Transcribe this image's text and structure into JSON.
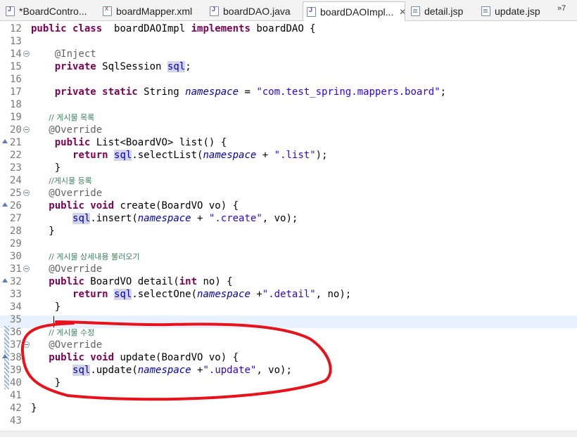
{
  "tabs": [
    {
      "label": "*BoardContro...",
      "icon": "java-file-icon",
      "active": false
    },
    {
      "label": "boardMapper.xml",
      "icon": "xml-file-icon",
      "active": false
    },
    {
      "label": "boardDAO.java",
      "icon": "java-file-icon",
      "active": false
    },
    {
      "label": "boardDAOImpl...",
      "icon": "java-file-icon",
      "active": true,
      "close": "✕"
    },
    {
      "label": "detail.jsp",
      "icon": "jsp-file-icon",
      "active": false
    },
    {
      "label": "update.jsp",
      "icon": "jsp-file-icon",
      "active": false
    }
  ],
  "overflow": "»7",
  "editor": {
    "current_line": 35,
    "lines": [
      {
        "num": "12",
        "code": [
          [
            "kw",
            "public class"
          ],
          [
            "",
            "  boardDAOImpl "
          ],
          [
            "kw",
            "implements"
          ],
          [
            "",
            " boardDAO {"
          ]
        ]
      },
      {
        "num": "13",
        "code": []
      },
      {
        "num": "14",
        "fold": true,
        "code": [
          [
            "",
            "    "
          ],
          [
            "ann",
            "@Inject"
          ]
        ]
      },
      {
        "num": "15",
        "code": [
          [
            "",
            "    "
          ],
          [
            "kw",
            "private"
          ],
          [
            "",
            " SqlSession "
          ],
          [
            "occ",
            "sql"
          ],
          [
            "",
            ";"
          ]
        ]
      },
      {
        "num": "16",
        "code": []
      },
      {
        "num": "17",
        "code": [
          [
            "",
            "    "
          ],
          [
            "kw",
            "private static"
          ],
          [
            "",
            " String "
          ],
          [
            "fld",
            "namespace"
          ],
          [
            "",
            " = "
          ],
          [
            "str",
            "\"com.test_spring.mappers.board\""
          ],
          [
            "",
            ";"
          ]
        ]
      },
      {
        "num": "18",
        "code": []
      },
      {
        "num": "19",
        "code": [
          [
            "",
            "   "
          ],
          [
            "cm",
            "// 게시물 목록"
          ]
        ]
      },
      {
        "num": "20",
        "fold": true,
        "code": [
          [
            "",
            "   "
          ],
          [
            "ann",
            "@Override"
          ]
        ]
      },
      {
        "num": "21",
        "override": true,
        "code": [
          [
            "",
            "    "
          ],
          [
            "kw",
            "public"
          ],
          [
            "",
            " List<BoardVO> list() {"
          ]
        ]
      },
      {
        "num": "22",
        "code": [
          [
            "",
            "       "
          ],
          [
            "kw",
            "return"
          ],
          [
            "",
            " "
          ],
          [
            "occ",
            "sql"
          ],
          [
            "",
            ".selectList("
          ],
          [
            "fld",
            "namespace"
          ],
          [
            "",
            " + "
          ],
          [
            "str",
            "\".list\""
          ],
          [
            "",
            ");"
          ]
        ]
      },
      {
        "num": "23",
        "code": [
          [
            "",
            "    }"
          ]
        ]
      },
      {
        "num": "24",
        "code": [
          [
            "",
            "   "
          ],
          [
            "cm",
            "//게시물 등록"
          ]
        ]
      },
      {
        "num": "25",
        "fold": true,
        "code": [
          [
            "",
            "   "
          ],
          [
            "ann",
            "@Override"
          ]
        ]
      },
      {
        "num": "26",
        "override": true,
        "code": [
          [
            "",
            "   "
          ],
          [
            "kw",
            "public void"
          ],
          [
            "",
            " create(BoardVO vo) {"
          ]
        ]
      },
      {
        "num": "27",
        "code": [
          [
            "",
            "       "
          ],
          [
            "occ",
            "sql"
          ],
          [
            "",
            ".insert("
          ],
          [
            "fld",
            "namespace"
          ],
          [
            "",
            " + "
          ],
          [
            "str",
            "\".create\""
          ],
          [
            "",
            ", vo);"
          ]
        ]
      },
      {
        "num": "28",
        "code": [
          [
            "",
            "   }"
          ]
        ]
      },
      {
        "num": "29",
        "code": []
      },
      {
        "num": "30",
        "code": [
          [
            "",
            "   "
          ],
          [
            "cm",
            "// 게시물 상세내용 불러오기"
          ]
        ]
      },
      {
        "num": "31",
        "fold": true,
        "code": [
          [
            "",
            "   "
          ],
          [
            "ann",
            "@Override"
          ]
        ]
      },
      {
        "num": "32",
        "override": true,
        "code": [
          [
            "",
            "   "
          ],
          [
            "kw",
            "public"
          ],
          [
            "",
            " BoardVO detail("
          ],
          [
            "kw",
            "int"
          ],
          [
            "",
            " no) {"
          ]
        ]
      },
      {
        "num": "33",
        "code": [
          [
            "",
            "       "
          ],
          [
            "kw",
            "return"
          ],
          [
            "",
            " "
          ],
          [
            "occ",
            "sql"
          ],
          [
            "",
            ".selectOne("
          ],
          [
            "fld",
            "namespace"
          ],
          [
            "",
            " +"
          ],
          [
            "str",
            "\".detail\""
          ],
          [
            "",
            ", no);"
          ]
        ]
      },
      {
        "num": "34",
        "code": [
          [
            "",
            "    }"
          ]
        ]
      },
      {
        "num": "35",
        "code": []
      },
      {
        "num": "36",
        "changed": true,
        "code": [
          [
            "",
            "   "
          ],
          [
            "cm",
            "// 게시물 수정"
          ]
        ]
      },
      {
        "num": "37",
        "changed": true,
        "fold": true,
        "code": [
          [
            "",
            "   "
          ],
          [
            "ann",
            "@Override"
          ]
        ]
      },
      {
        "num": "38",
        "changed": true,
        "override": true,
        "code": [
          [
            "",
            "   "
          ],
          [
            "kw",
            "public void"
          ],
          [
            "",
            " update(BoardVO vo) {"
          ]
        ]
      },
      {
        "num": "39",
        "changed": true,
        "code": [
          [
            "",
            "       "
          ],
          [
            "occ",
            "sql"
          ],
          [
            "",
            ".update("
          ],
          [
            "fld",
            "namespace"
          ],
          [
            "",
            " +"
          ],
          [
            "str",
            "\".update\""
          ],
          [
            "",
            ", vo);"
          ]
        ]
      },
      {
        "num": "40",
        "changed": true,
        "code": [
          [
            "",
            "    }"
          ]
        ]
      },
      {
        "num": "41",
        "code": []
      },
      {
        "num": "42",
        "code": [
          [
            "",
            "}"
          ]
        ]
      },
      {
        "num": "43",
        "code": []
      }
    ]
  },
  "annotation_color": "#e8121b"
}
